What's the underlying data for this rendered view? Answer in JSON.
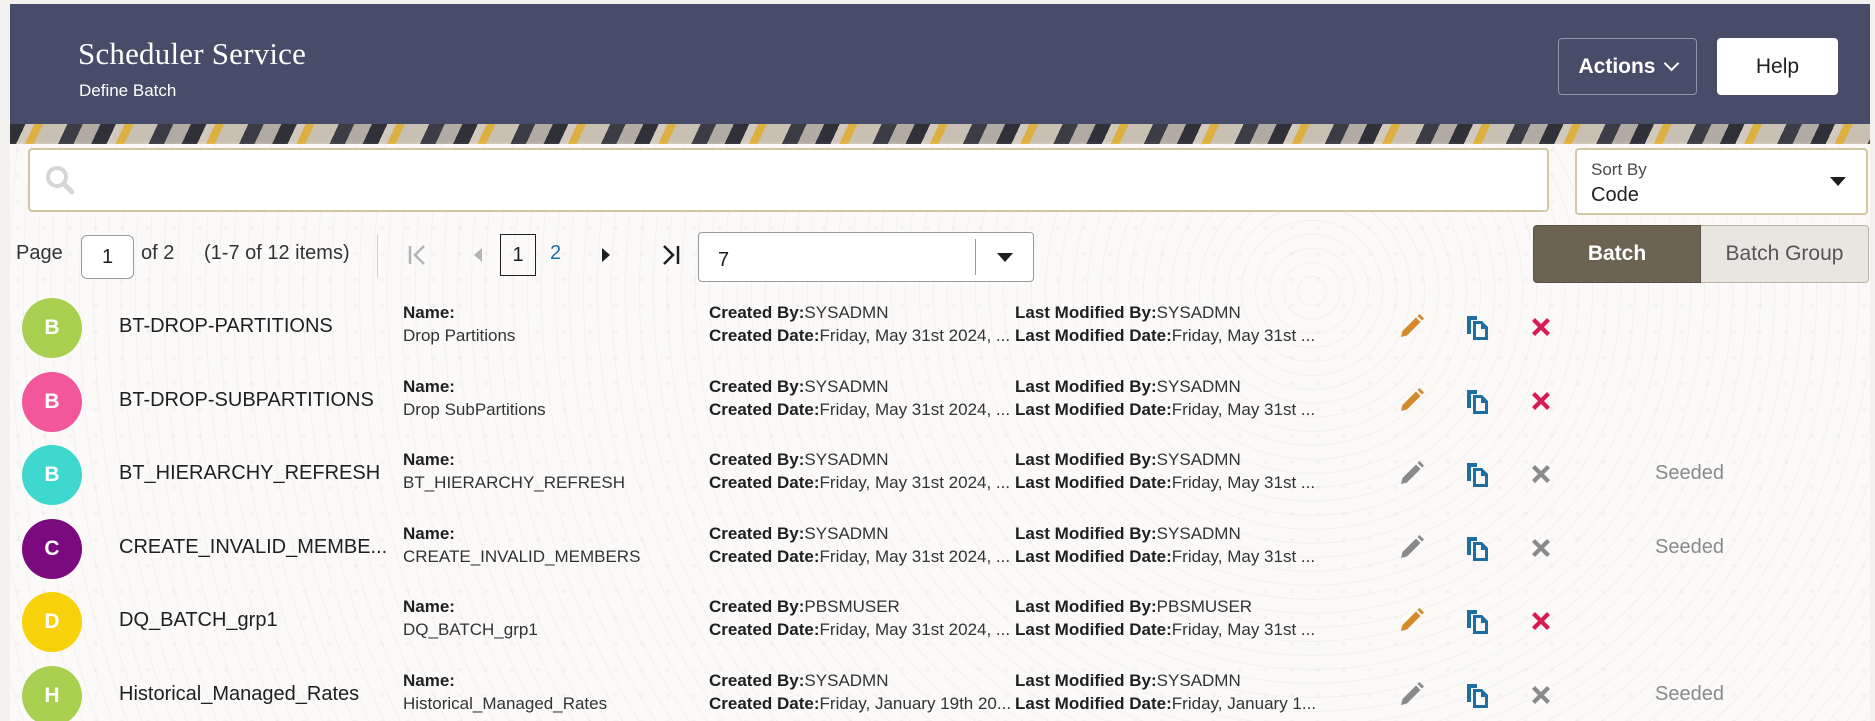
{
  "header": {
    "title": "Scheduler Service",
    "subtitle": "Define Batch",
    "actions_label": "Actions",
    "help_label": "Help"
  },
  "search": {
    "placeholder": "",
    "value": ""
  },
  "sort": {
    "label": "Sort By",
    "value": "Code"
  },
  "pagination": {
    "page_label": "Page",
    "current_page": "1",
    "of_label": "of 2",
    "items_label": "(1-7 of 12 items)",
    "pages": [
      "1",
      "2"
    ],
    "page_size": "7"
  },
  "toggle": {
    "batch": "Batch",
    "batch_group": "Batch Group",
    "selected": "Batch"
  },
  "labels": {
    "name": "Name:",
    "created_by": "Created By:",
    "created_date": "Created Date:",
    "modified_by": "Last Modified By:",
    "modified_date": "Last Modified Date:"
  },
  "colors": {
    "header_bg": "#474c69",
    "edit_active": "#d4892b",
    "delete_active": "#d81b50",
    "icon_disabled": "#8a8a8a",
    "copy": "#1d6fa3"
  },
  "rows": [
    {
      "initial": "B",
      "avatar_color": "#a8cf4f",
      "code": "BT-DROP-PARTITIONS",
      "name": "Drop Partitions",
      "created_by": "SYSADMN",
      "created_date": "Friday, May 31st 2024, ...",
      "modified_by": "SYSADMN",
      "modified_date": "Friday, May 31st ...",
      "seeded": "",
      "editable": true
    },
    {
      "initial": "B",
      "avatar_color": "#f2579a",
      "code": "BT-DROP-SUBPARTITIONS",
      "name": "Drop SubPartitions",
      "created_by": "SYSADMN",
      "created_date": "Friday, May 31st 2024, ...",
      "modified_by": "SYSADMN",
      "modified_date": "Friday, May 31st ...",
      "seeded": "",
      "editable": true
    },
    {
      "initial": "B",
      "avatar_color": "#3fd8cf",
      "code": "BT_HIERARCHY_REFRESH",
      "name": "BT_HIERARCHY_REFRESH",
      "created_by": "SYSADMN",
      "created_date": "Friday, May 31st 2024, ...",
      "modified_by": "SYSADMN",
      "modified_date": "Friday, May 31st ...",
      "seeded": "Seeded",
      "editable": false
    },
    {
      "initial": "C",
      "avatar_color": "#7a0a7e",
      "code": "CREATE_INVALID_MEMBE...",
      "name": "CREATE_INVALID_MEMBERS",
      "created_by": "SYSADMN",
      "created_date": "Friday, May 31st 2024, ...",
      "modified_by": "SYSADMN",
      "modified_date": "Friday, May 31st ...",
      "seeded": "Seeded",
      "editable": false
    },
    {
      "initial": "D",
      "avatar_color": "#f7d10a",
      "code": "DQ_BATCH_grp1",
      "name": "DQ_BATCH_grp1",
      "created_by": "PBSMUSER",
      "created_date": "Friday, May 31st 2024, ...",
      "modified_by": "PBSMUSER",
      "modified_date": "Friday, May 31st ...",
      "seeded": "",
      "editable": true
    },
    {
      "initial": "H",
      "avatar_color": "#a8cf4f",
      "code": "Historical_Managed_Rates",
      "name": "Historical_Managed_Rates",
      "created_by": "SYSADMN",
      "created_date": "Friday, January 19th 20...",
      "modified_by": "SYSADMN",
      "modified_date": "Friday, January 1...",
      "seeded": "Seeded",
      "editable": false
    }
  ]
}
